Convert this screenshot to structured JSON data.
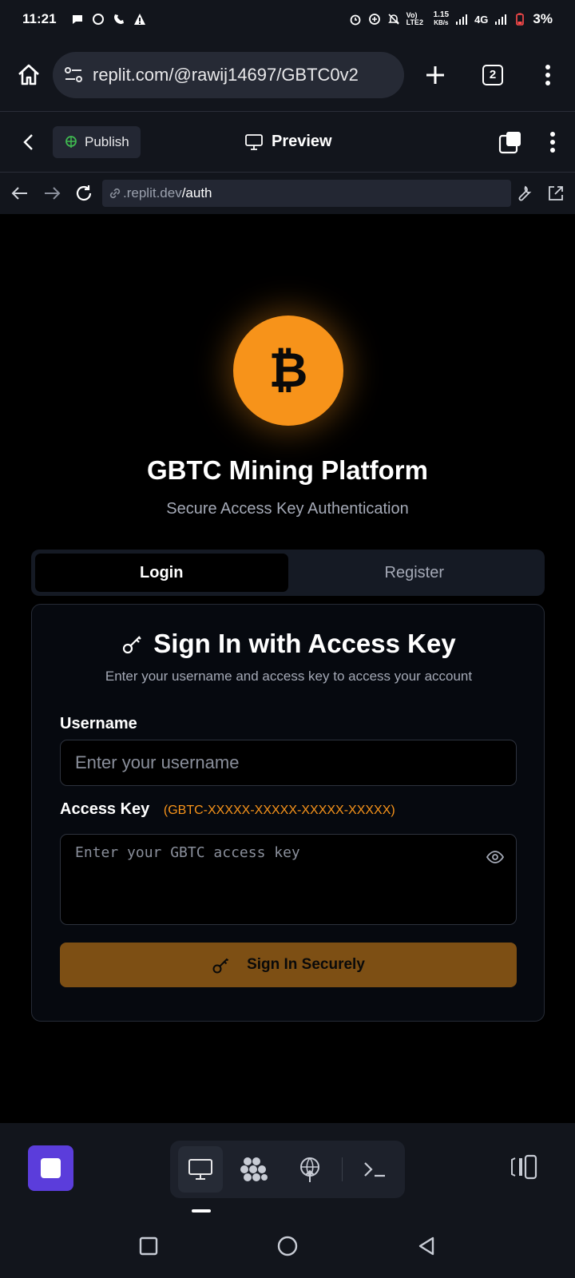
{
  "status_bar": {
    "time": "11:21",
    "network_speed": "1.15",
    "network_speed_unit": "KB/s",
    "volte": "Vo) LTE2",
    "network_type": "4G",
    "battery": "3%"
  },
  "browser": {
    "url": "replit.com/@rawij14697/GBTC0v2",
    "tab_count": "2"
  },
  "replit_header": {
    "publish_label": "Publish",
    "preview_label": "Preview"
  },
  "preview_bar": {
    "url_domain": ".replit.dev",
    "url_path": "/auth"
  },
  "page": {
    "logo_symbol": "₿",
    "title": "GBTC Mining Platform",
    "subtitle": "Secure Access Key Authentication",
    "tabs": [
      {
        "label": "Login",
        "active": true
      },
      {
        "label": "Register",
        "active": false
      }
    ],
    "card": {
      "title": "Sign In with Access Key",
      "description": "Enter your username and access key to access your account",
      "username_label": "Username",
      "username_placeholder": "Enter your username",
      "access_key_label": "Access Key",
      "access_key_format": "(GBTC-XXXXX-XXXXX-XXXXX-XXXXX)",
      "access_key_placeholder": "Enter your GBTC access key",
      "submit_label": "Sign In Securely"
    }
  },
  "colors": {
    "accent": "#f7931a",
    "submit_bg": "#7d4f14",
    "stop_button": "#5b3ddb"
  },
  "icons": [
    "home-icon",
    "tune-icon",
    "plus-icon",
    "kebab-icon",
    "chevron-left-icon",
    "globe-icon",
    "monitor-icon",
    "key-icon",
    "eye-icon",
    "wrench-icon",
    "external-link-icon",
    "refresh-icon",
    "console-icon",
    "deploy-icon"
  ]
}
